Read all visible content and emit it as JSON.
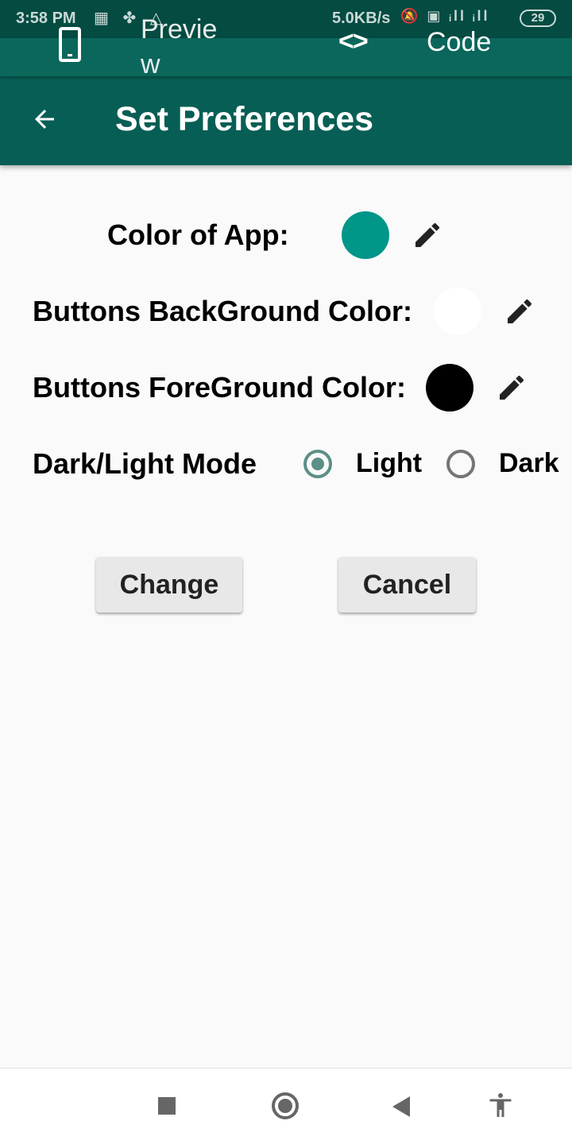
{
  "status_bar": {
    "time": "3:58 PM",
    "left_icons": "▦ ✤ △",
    "speed": "5.0KB/s",
    "right_icons": "🔕 ▣ ᵢll ᵢll",
    "battery": "29"
  },
  "tabs": {
    "preview_label": "Preview",
    "preview_icon": "phone-icon",
    "code_label": "Code",
    "code_icon_glyph": "<>"
  },
  "app_bar": {
    "title": "Set Preferences",
    "back_icon": "arrow-left-icon"
  },
  "preferences": {
    "app_color_label": "Color of App:",
    "app_color": "#009688",
    "bg_color_label": "Buttons BackGround Color:",
    "bg_color": "#ffffff",
    "fg_color_label": "Buttons ForeGround Color:",
    "fg_color": "#000000",
    "mode_label": "Dark/Light Mode",
    "light_label": "Light",
    "dark_label": "Dark",
    "selected_mode": "Light"
  },
  "actions": {
    "change_label": "Change",
    "cancel_label": "Cancel"
  },
  "colors": {
    "status_bar": "#044b42",
    "tab_strip": "#0b675b",
    "app_bar": "#075e54",
    "radio_accent": "#5b8f88"
  }
}
